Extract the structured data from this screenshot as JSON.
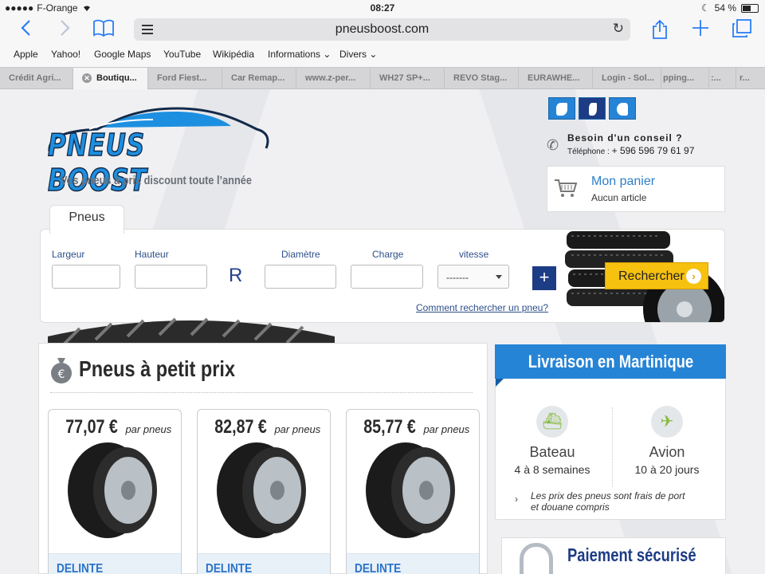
{
  "status": {
    "carrier": "F-Orange",
    "time": "08:27",
    "battery": "54 %",
    "battery_level": 0.54
  },
  "browser": {
    "url": "pneusboost.com",
    "bookmarks": [
      "Apple",
      "Yahoo!",
      "Google Maps",
      "YouTube",
      "Wikipédia",
      "Informations ⌄",
      "Divers ⌄"
    ],
    "tabs": [
      "Crédit Agri...",
      "Boutiqu...",
      "Ford Fiest...",
      "Car Remap...",
      "www.z-per...",
      "WH27 SP+...",
      "REVO Stag...",
      "EURAWHE...",
      "Login - Sol...",
      "pping...",
      ":...",
      "r..."
    ]
  },
  "header": {
    "logo_text": "PNEUS BOOST",
    "tagline": "Vos pneus à prix discount toute l’année",
    "contact_title": "Besoin d'un conseil ?",
    "contact_phone_label": "Téléphone : ",
    "contact_phone": "+ 596 596 79 61 97",
    "cart_title": "Mon panier",
    "cart_status": "Aucun article"
  },
  "search": {
    "tab_label": "Pneus",
    "label_largeur": "Largeur",
    "label_hauteur": "Hauteur",
    "r_letter": "R",
    "label_diametre": "Diamètre",
    "label_charge": "Charge",
    "label_vitesse": "vitesse",
    "vitesse_value": "-------",
    "plus_label": "+",
    "help_link": "Comment rechercher un pneu?",
    "submit_label": "Rechercher"
  },
  "products": {
    "title": "Pneus à petit prix",
    "per_unit": "par pneus",
    "items": [
      {
        "price": "77,07 €",
        "brand": "DELINTE"
      },
      {
        "price": "82,87 €",
        "brand": "DELINTE"
      },
      {
        "price": "85,77 €",
        "brand": "DELINTE"
      }
    ]
  },
  "delivery": {
    "title": "Livraison en Martinique",
    "modes": [
      {
        "name": "Bateau",
        "delay": "4 à 8 semaines",
        "icon": "boat-icon"
      },
      {
        "name": "Avion",
        "delay": "10 à 20 jours",
        "icon": "plane-icon"
      }
    ],
    "note_line1": "Les prix des pneus sont frais de port",
    "note_line2": "et douane compris"
  },
  "payment": {
    "title": "Paiement sécurisé"
  },
  "colors": {
    "accent_blue": "#2684d6",
    "dark_blue": "#1d3c86",
    "button_yellow": "#f7c10f",
    "ios_blue": "#2a7ef5"
  }
}
